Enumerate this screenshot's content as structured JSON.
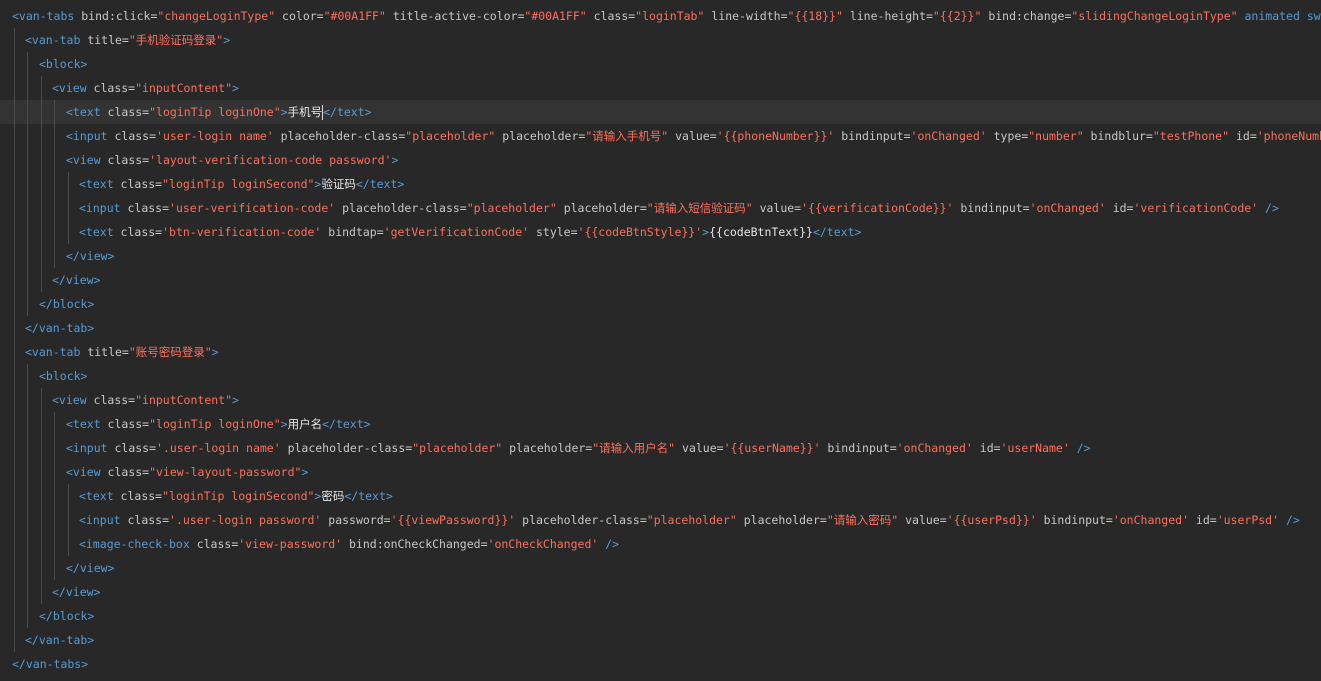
{
  "editor": {
    "current_line": 4,
    "lines": [
      {
        "indent": 0,
        "tokens": [
          [
            "tag",
            "<van-tabs "
          ],
          [
            "attr",
            "bind:click="
          ],
          [
            "str",
            "\"changeLoginType\""
          ],
          [
            "attr",
            " color="
          ],
          [
            "str",
            "\"#00A1FF\""
          ],
          [
            "attr",
            " title-active-color="
          ],
          [
            "str",
            "\"#00A1FF\""
          ],
          [
            "attr",
            " class="
          ],
          [
            "str",
            "\"loginTab\""
          ],
          [
            "attr",
            " line-width="
          ],
          [
            "str",
            "\"{{18}}\""
          ],
          [
            "attr",
            " line-height="
          ],
          [
            "str",
            "\"{{2}}\""
          ],
          [
            "attr",
            " bind:change="
          ],
          [
            "str",
            "\"slidingChangeLoginType\""
          ],
          [
            "tag",
            " animated swipeable>"
          ]
        ]
      },
      {
        "indent": 1,
        "tokens": [
          [
            "tag",
            "<van-tab "
          ],
          [
            "attr",
            "title="
          ],
          [
            "str",
            "\"手机验证码登录\""
          ],
          [
            "tag",
            ">"
          ]
        ]
      },
      {
        "indent": 2,
        "tokens": [
          [
            "tag",
            "<block>"
          ]
        ]
      },
      {
        "indent": 3,
        "tokens": [
          [
            "tag",
            "<view "
          ],
          [
            "attr",
            "class="
          ],
          [
            "str",
            "\"inputContent\""
          ],
          [
            "tag",
            ">"
          ]
        ]
      },
      {
        "indent": 4,
        "tokens": [
          [
            "tag",
            "<text "
          ],
          [
            "attr",
            "class="
          ],
          [
            "str",
            "\"loginTip loginOne\""
          ],
          [
            "tag",
            ">"
          ],
          [
            "txt",
            "手机号"
          ],
          [
            "caret",
            ""
          ],
          [
            "tag",
            "</text>"
          ]
        ]
      },
      {
        "indent": 4,
        "tokens": [
          [
            "tag",
            "<input "
          ],
          [
            "attr",
            "class="
          ],
          [
            "str",
            "'user-login name'"
          ],
          [
            "attr",
            " placeholder-class="
          ],
          [
            "str",
            "\"placeholder\""
          ],
          [
            "attr",
            " placeholder="
          ],
          [
            "str",
            "\"请输入手机号\""
          ],
          [
            "attr",
            " value="
          ],
          [
            "str",
            "'{{phoneNumber}}'"
          ],
          [
            "attr",
            " bindinput="
          ],
          [
            "str",
            "'onChanged'"
          ],
          [
            "attr",
            " type="
          ],
          [
            "str",
            "\"number\""
          ],
          [
            "attr",
            " bindblur="
          ],
          [
            "str",
            "\"testPhone\""
          ],
          [
            "attr",
            " id="
          ],
          [
            "str",
            "'phoneNumber'"
          ],
          [
            "tag",
            " />"
          ]
        ]
      },
      {
        "indent": 4,
        "tokens": [
          [
            "tag",
            "<view "
          ],
          [
            "attr",
            "class="
          ],
          [
            "str",
            "'layout-verification-code password'"
          ],
          [
            "tag",
            ">"
          ]
        ]
      },
      {
        "indent": 5,
        "tokens": [
          [
            "tag",
            "<text "
          ],
          [
            "attr",
            "class="
          ],
          [
            "str",
            "\"loginTip loginSecond\""
          ],
          [
            "tag",
            ">"
          ],
          [
            "txt",
            "验证码"
          ],
          [
            "tag",
            "</text>"
          ]
        ]
      },
      {
        "indent": 5,
        "tokens": [
          [
            "tag",
            "<input "
          ],
          [
            "attr",
            "class="
          ],
          [
            "str",
            "'user-verification-code'"
          ],
          [
            "attr",
            " placeholder-class="
          ],
          [
            "str",
            "\"placeholder\""
          ],
          [
            "attr",
            " placeholder="
          ],
          [
            "str",
            "\"请输入短信验证码\""
          ],
          [
            "attr",
            " value="
          ],
          [
            "str",
            "'{{verificationCode}}'"
          ],
          [
            "attr",
            " bindinput="
          ],
          [
            "str",
            "'onChanged'"
          ],
          [
            "attr",
            " id="
          ],
          [
            "str",
            "'verificationCode'"
          ],
          [
            "tag",
            " />"
          ]
        ]
      },
      {
        "indent": 5,
        "tokens": [
          [
            "tag",
            "<text "
          ],
          [
            "attr",
            "class="
          ],
          [
            "str",
            "'btn-verification-code'"
          ],
          [
            "attr",
            " bindtap="
          ],
          [
            "str",
            "'getVerificationCode'"
          ],
          [
            "attr",
            " style="
          ],
          [
            "str",
            "'{{codeBtnStyle}}'"
          ],
          [
            "tag",
            ">"
          ],
          [
            "txt",
            "{{codeBtnText}}"
          ],
          [
            "tag",
            "</text>"
          ]
        ]
      },
      {
        "indent": 4,
        "tokens": [
          [
            "tag",
            "</view>"
          ]
        ]
      },
      {
        "indent": 3,
        "tokens": [
          [
            "tag",
            "</view>"
          ]
        ]
      },
      {
        "indent": 2,
        "tokens": [
          [
            "tag",
            "</block>"
          ]
        ]
      },
      {
        "indent": 1,
        "tokens": [
          [
            "tag",
            "</van-tab>"
          ]
        ]
      },
      {
        "indent": 1,
        "tokens": [
          [
            "tag",
            "<van-tab "
          ],
          [
            "attr",
            "title="
          ],
          [
            "str",
            "\"账号密码登录\""
          ],
          [
            "tag",
            ">"
          ]
        ]
      },
      {
        "indent": 2,
        "tokens": [
          [
            "tag",
            "<block>"
          ]
        ]
      },
      {
        "indent": 3,
        "tokens": [
          [
            "tag",
            "<view "
          ],
          [
            "attr",
            "class="
          ],
          [
            "str",
            "\"inputContent\""
          ],
          [
            "tag",
            ">"
          ]
        ]
      },
      {
        "indent": 4,
        "tokens": [
          [
            "tag",
            "<text "
          ],
          [
            "attr",
            "class="
          ],
          [
            "str",
            "\"loginTip loginOne\""
          ],
          [
            "tag",
            ">"
          ],
          [
            "txt",
            "用户名"
          ],
          [
            "tag",
            "</text>"
          ]
        ]
      },
      {
        "indent": 4,
        "tokens": [
          [
            "tag",
            "<input "
          ],
          [
            "attr",
            "class="
          ],
          [
            "str",
            "'.user-login name'"
          ],
          [
            "attr",
            " placeholder-class="
          ],
          [
            "str",
            "\"placeholder\""
          ],
          [
            "attr",
            " placeholder="
          ],
          [
            "str",
            "\"请输入用户名\""
          ],
          [
            "attr",
            " value="
          ],
          [
            "str",
            "'{{userName}}'"
          ],
          [
            "attr",
            " bindinput="
          ],
          [
            "str",
            "'onChanged'"
          ],
          [
            "attr",
            " id="
          ],
          [
            "str",
            "'userName'"
          ],
          [
            "tag",
            " />"
          ]
        ]
      },
      {
        "indent": 4,
        "tokens": [
          [
            "tag",
            "<view "
          ],
          [
            "attr",
            "class="
          ],
          [
            "str",
            "\"view-layout-password\""
          ],
          [
            "tag",
            ">"
          ]
        ]
      },
      {
        "indent": 5,
        "tokens": [
          [
            "tag",
            "<text "
          ],
          [
            "attr",
            "class="
          ],
          [
            "str",
            "\"loginTip loginSecond\""
          ],
          [
            "tag",
            ">"
          ],
          [
            "txt",
            "密码"
          ],
          [
            "tag",
            "</text>"
          ]
        ]
      },
      {
        "indent": 5,
        "tokens": [
          [
            "tag",
            "<input "
          ],
          [
            "attr",
            "class="
          ],
          [
            "str",
            "'.user-login password'"
          ],
          [
            "attr",
            " password="
          ],
          [
            "str",
            "'{{viewPassword}}'"
          ],
          [
            "attr",
            " placeholder-class="
          ],
          [
            "str",
            "\"placeholder\""
          ],
          [
            "attr",
            " placeholder="
          ],
          [
            "str",
            "\"请输入密码\""
          ],
          [
            "attr",
            " value="
          ],
          [
            "str",
            "'{{userPsd}}'"
          ],
          [
            "attr",
            " bindinput="
          ],
          [
            "str",
            "'onChanged'"
          ],
          [
            "attr",
            " id="
          ],
          [
            "str",
            "'userPsd'"
          ],
          [
            "tag",
            " />"
          ]
        ]
      },
      {
        "indent": 5,
        "tokens": [
          [
            "tag",
            "<image-check-box "
          ],
          [
            "attr",
            "class="
          ],
          [
            "str",
            "'view-password'"
          ],
          [
            "attr",
            " bind:onCheckChanged="
          ],
          [
            "str",
            "'onCheckChanged'"
          ],
          [
            "tag",
            " />"
          ]
        ]
      },
      {
        "indent": 4,
        "tokens": [
          [
            "tag",
            "</view>"
          ]
        ]
      },
      {
        "indent": 3,
        "tokens": [
          [
            "tag",
            "</view>"
          ]
        ]
      },
      {
        "indent": 2,
        "tokens": [
          [
            "tag",
            "</block>"
          ]
        ]
      },
      {
        "indent": 1,
        "tokens": [
          [
            "tag",
            "</van-tab>"
          ]
        ]
      },
      {
        "indent": 0,
        "tokens": [
          [
            "tag",
            "</van-tabs>"
          ]
        ]
      }
    ]
  }
}
